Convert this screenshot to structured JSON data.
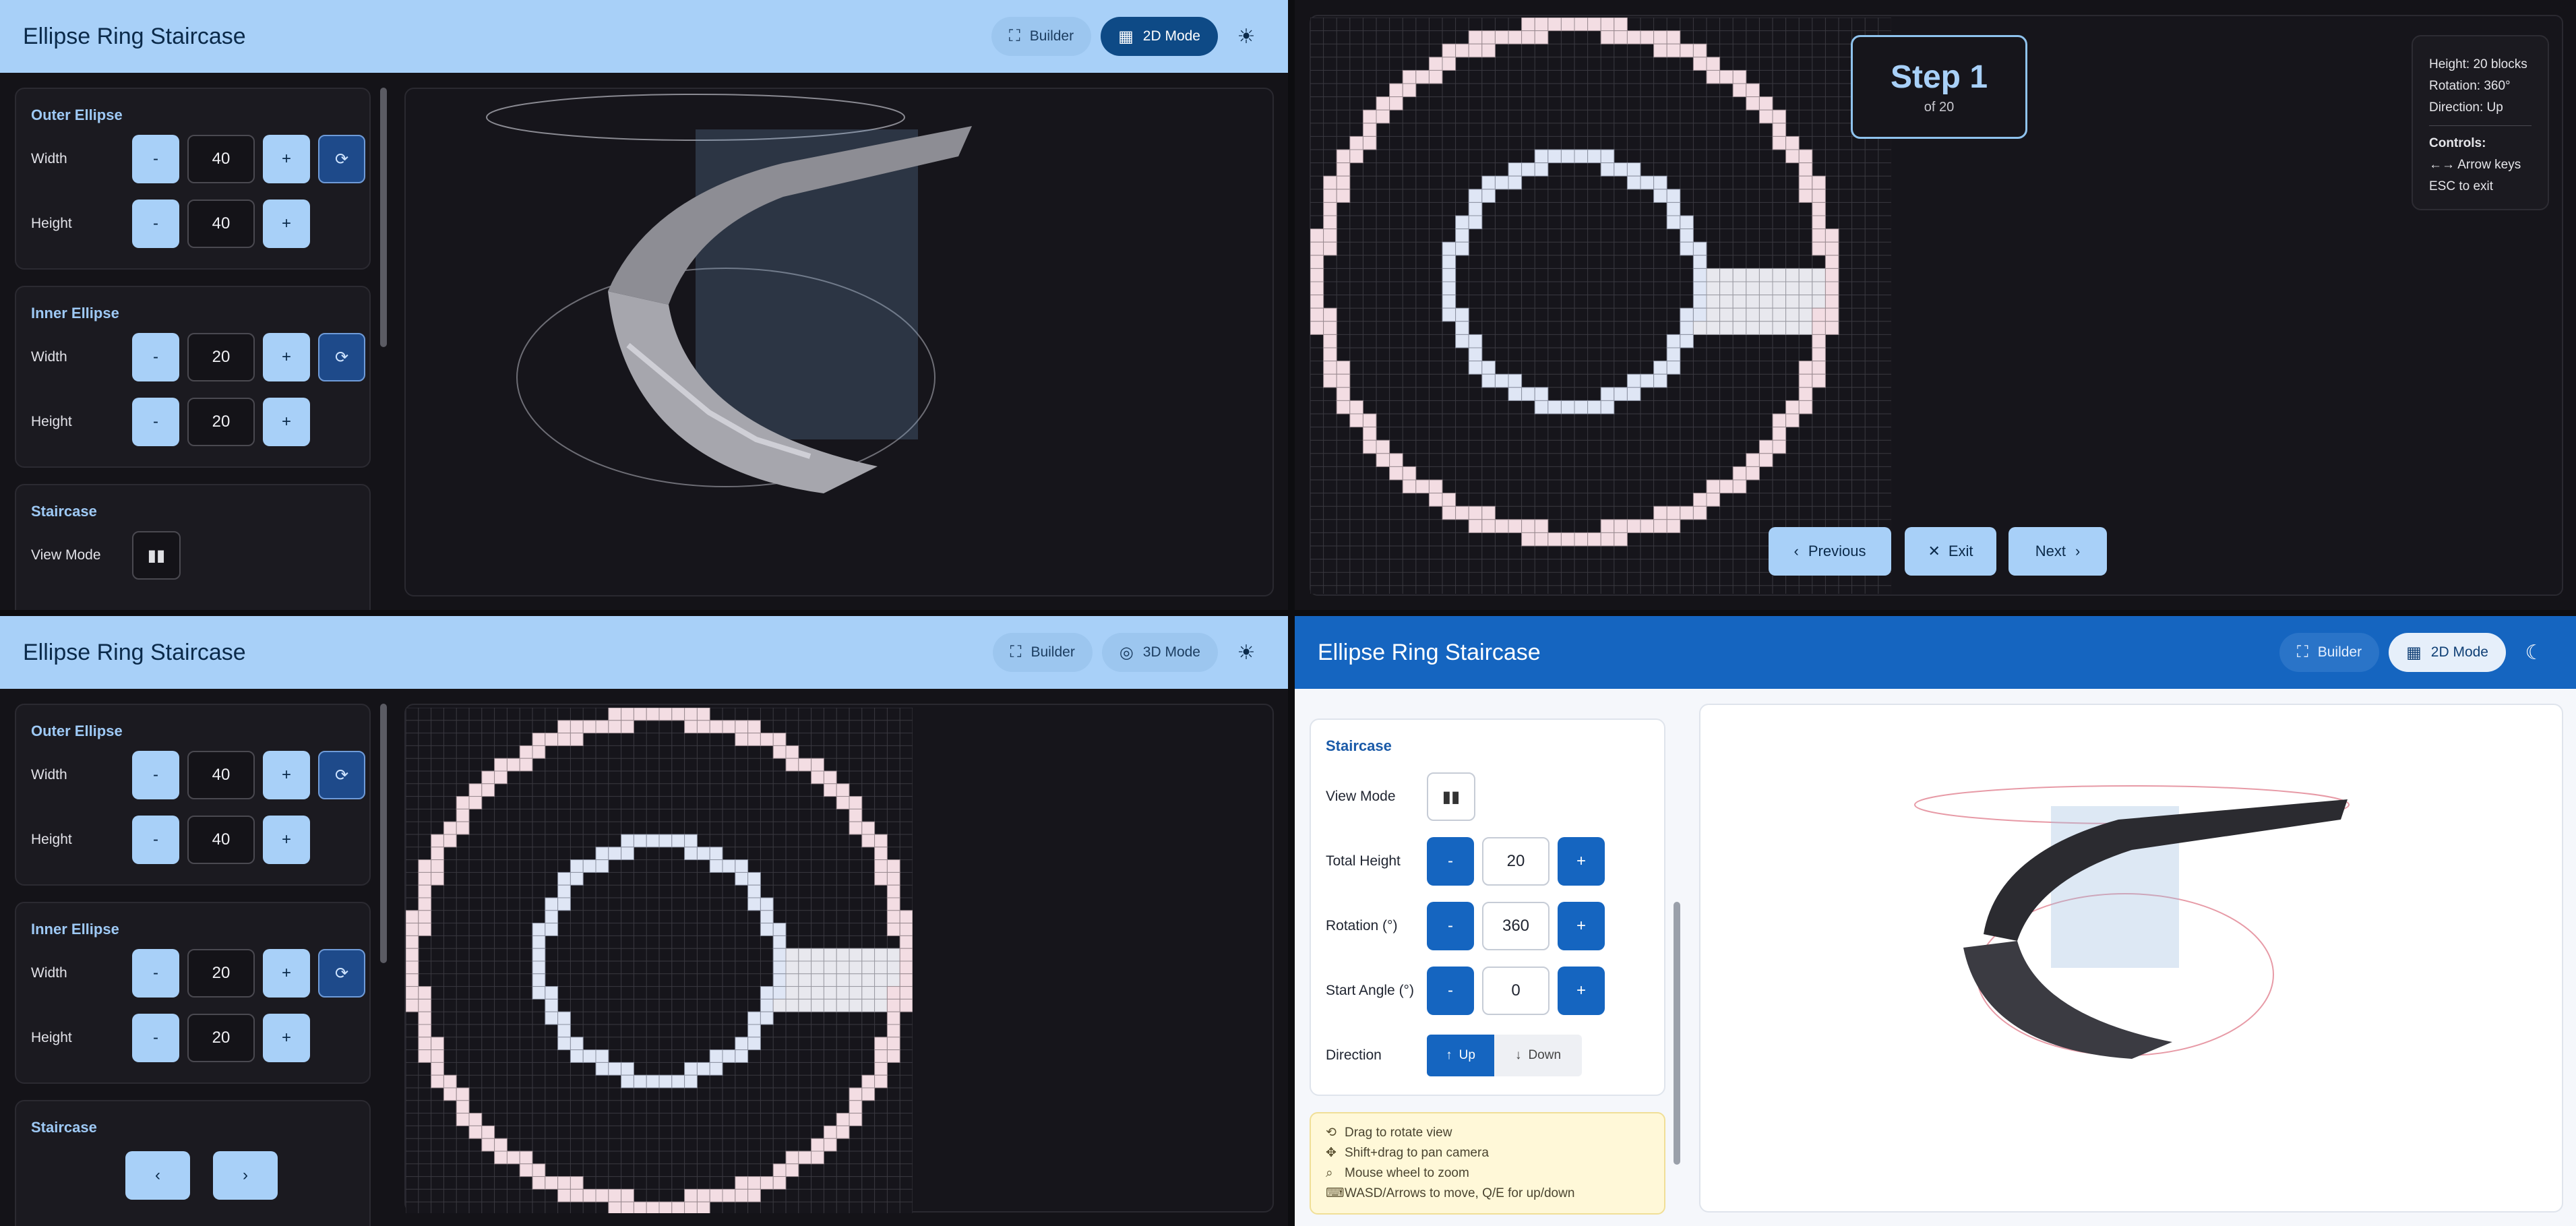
{
  "app_title": "Ellipse Ring Staircase",
  "header_buttons": {
    "builder": "Builder",
    "mode_2d": "2D Mode",
    "mode_3d": "3D Mode"
  },
  "outer_ellipse": {
    "title": "Outer Ellipse",
    "width_label": "Width",
    "width": "40",
    "height_label": "Height",
    "height": "40"
  },
  "inner_ellipse": {
    "title": "Inner Ellipse",
    "width_label": "Width",
    "width": "20",
    "height_label": "Height",
    "height": "20"
  },
  "staircase": {
    "title": "Staircase",
    "view_mode_label": "View Mode",
    "total_height_label": "Total Height",
    "total_height": "20",
    "rotation_label": "Rotation (°)",
    "rotation": "360",
    "start_angle_label": "Start Angle (°)",
    "start_angle": "0",
    "direction_label": "Direction",
    "up_label": "Up",
    "down_label": "Down"
  },
  "stepper": {
    "minus": "-",
    "plus": "+"
  },
  "step_indicator": {
    "title": "Step 1",
    "sub": "of 20"
  },
  "info": {
    "height": "Height: 20 blocks",
    "rotation": "Rotation: 360°",
    "direction": "Direction: Up",
    "controls_title": "Controls:",
    "arrows": "←→ Arrow keys",
    "esc": "ESC to exit"
  },
  "nav": {
    "previous": "Previous",
    "exit": "Exit",
    "next": "Next"
  },
  "hints": [
    "Drag to rotate view",
    "Shift+drag to pan camera",
    "Mouse wheel to zoom",
    "WASD/Arrows to move, Q/E for up/down"
  ],
  "icons": {
    "builder": "fullscreen-icon",
    "mode_2d": "grid-icon",
    "mode_3d": "3d-rotation-icon",
    "theme_light": "sun-icon",
    "theme_dark": "moon-icon",
    "sync": "sync-icon",
    "view_mode": "view-mode-icon"
  },
  "colors": {
    "primary_dark_theme": "#a8d0f8",
    "primary_light_theme": "#1565c0",
    "outer_ring_block": "#f3dde3",
    "inner_ring_block": "#dfe6f5"
  }
}
